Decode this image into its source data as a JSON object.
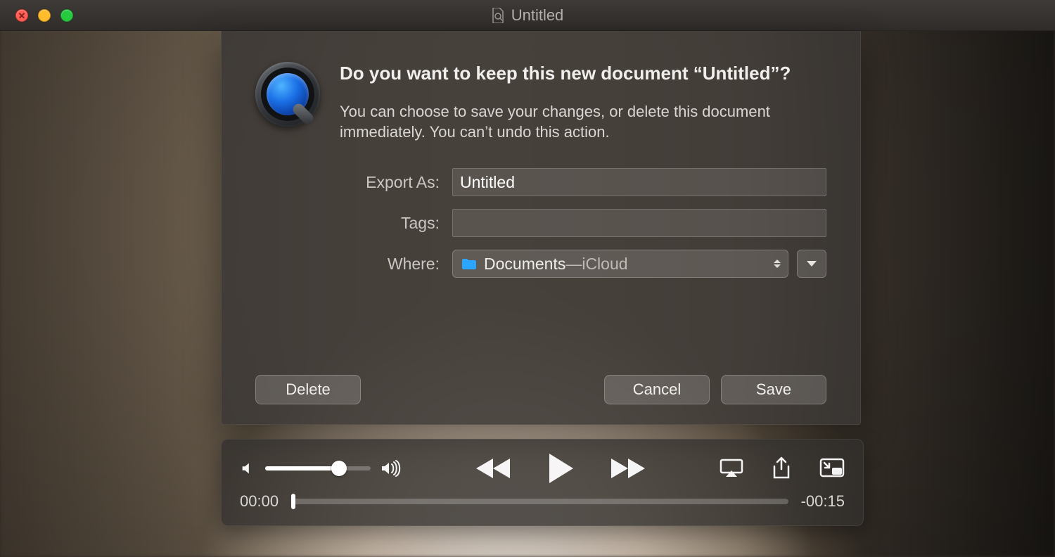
{
  "window": {
    "title": "Untitled"
  },
  "dialog": {
    "heading": "Do you want to keep this new document “Untitled”?",
    "body": "You can choose to save your changes, or delete this document immediately. You can’t undo this action.",
    "fields": {
      "export_as_label": "Export As:",
      "export_as_value": "Untitled",
      "tags_label": "Tags:",
      "tags_value": "",
      "where_label": "Where:",
      "where_folder": "Documents",
      "where_separator": " — ",
      "where_source": "iCloud"
    },
    "buttons": {
      "delete": "Delete",
      "cancel": "Cancel",
      "save": "Save"
    }
  },
  "player": {
    "elapsed": "00:00",
    "remaining": "-00:15",
    "volume_percent": 70,
    "progress_percent": 0
  }
}
